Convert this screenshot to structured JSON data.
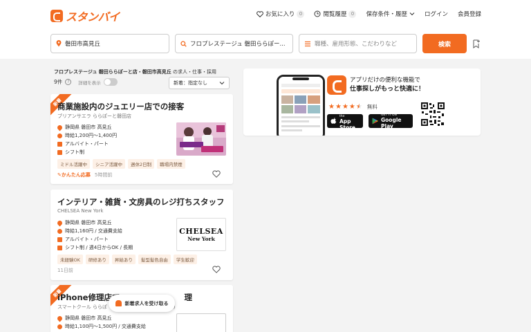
{
  "header": {
    "logo_text": "スタンバイ",
    "nav": {
      "favorites": "お気に入り",
      "favorites_count": "0",
      "history": "閲覧履歴",
      "history_count": "0",
      "saved": "保存条件・履歴",
      "login": "ログイン",
      "register": "会員登録"
    }
  },
  "search": {
    "location_value": "磐田市高見丘",
    "keyword_value": "フロプレステージュ 磐田ららぽー...",
    "condition_placeholder": "職種、雇用形態、こだわりなど",
    "search_button": "検索"
  },
  "results": {
    "heading_bold": "フロプレステージュ 磐田ららぽーと店・磐田市高見丘",
    "heading_suffix": " の求人・仕事・採用",
    "count": "9件",
    "toggle_label": "詳細を表示",
    "sort_label": "新着：指定なし"
  },
  "jobs": [
    {
      "badge": "新着",
      "title": "商業施設内のジュエリー店での接客",
      "company": "ブリアンサエラ ららぽーと磐田店",
      "location": "静岡県 磐田市 高見丘",
      "salary": "時給1,200円〜1,400円",
      "employment": "アルバイト・パート",
      "schedule": "シフト制",
      "tags": [
        "ミドル活躍中",
        "シニア活躍中",
        "週休2日制",
        "職場内禁煙"
      ],
      "easy_apply": "かんたん応募",
      "posted": "5時間前"
    },
    {
      "title": "インテリア・雑貨・文房具のレジ打ちスタッフ",
      "company": "CHELSEA New York",
      "location": "静岡県 磐田市 高見丘",
      "salary": "時給1,160円 / 交通費支給",
      "employment": "アルバイト・パート",
      "schedule": "シフト制 / 週4日からOK / 長期",
      "tags": [
        "未経験OK",
        "研修あり",
        "昇給あり",
        "髪型髪色自由",
        "学生歓迎"
      ],
      "posted": "11日前",
      "logo_line1": "CHELSEA",
      "logo_line2": "New York"
    },
    {
      "badge": "新着",
      "title": "iPhone修理店で",
      "title_tail": "理",
      "company": "スマートクール ららぽ",
      "company_tail": "ks)",
      "location": "静岡県 磐田市 高見丘",
      "salary": "時給1,100円〜1,500円 / 交通費支給"
    }
  ],
  "toast": {
    "label": "新着求人を受け取る"
  },
  "promo": {
    "line1": "アプリだけの便利な機能で",
    "line2": "仕事探しがもっと快適に！",
    "free": "無料",
    "rating": 4.5,
    "appstore_small": "Download on the",
    "appstore": "App Store",
    "googleplay_small": "GET IT ON",
    "googleplay": "Google Play"
  },
  "colors": {
    "accent": "#f26b21",
    "tag_bg": "#fdf0e6"
  }
}
